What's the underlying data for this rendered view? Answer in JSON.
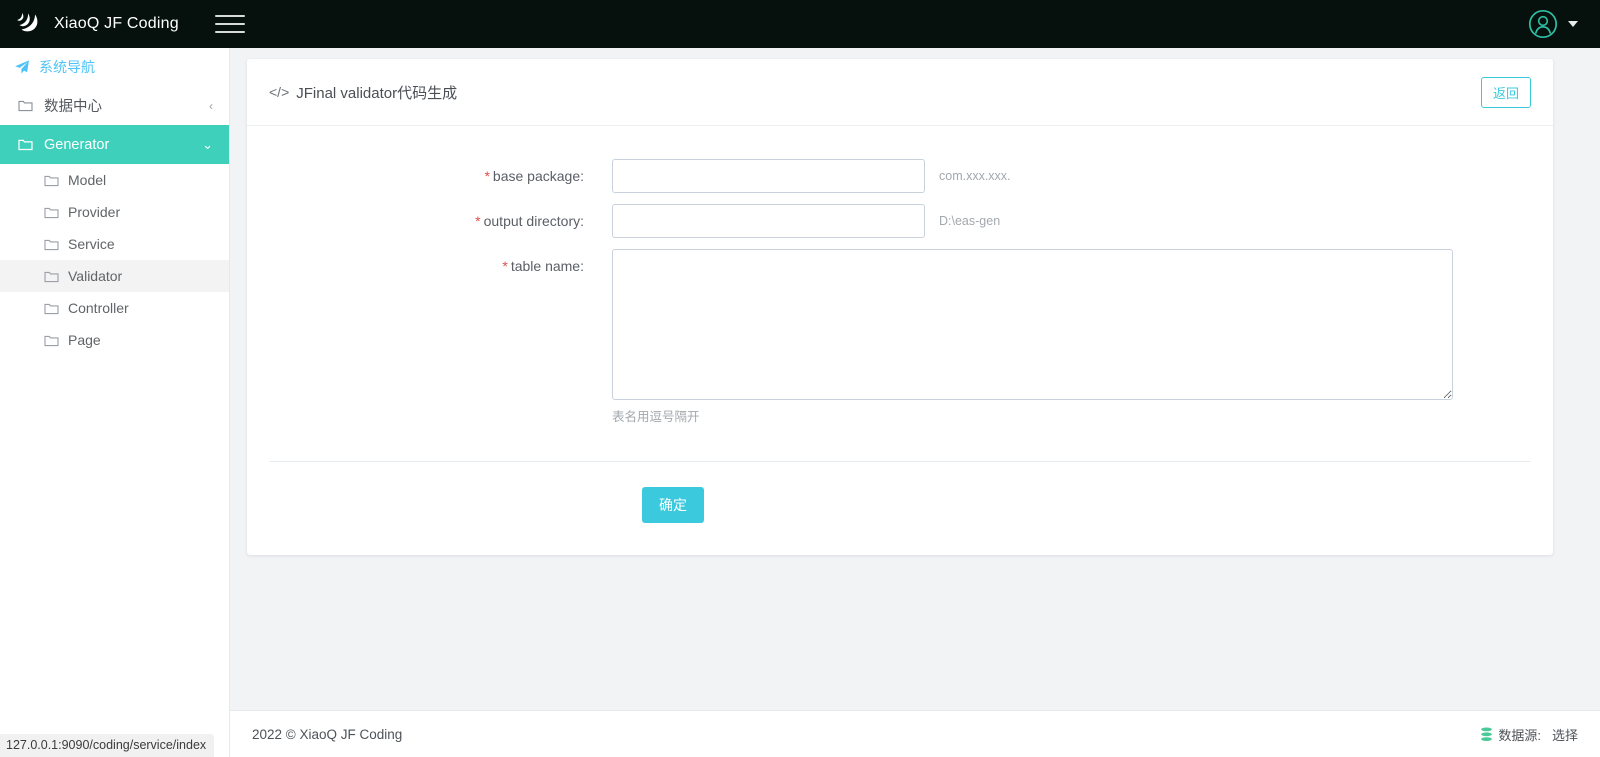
{
  "topbar": {
    "logo_icon": "crescent-logo-icon",
    "brand": "XiaoQ JF Coding",
    "menu_icon": "hamburger-icon",
    "avatar_icon": "user-avatar-icon",
    "caret_icon": "chevron-down-icon"
  },
  "sidebar": {
    "nav_header": "系统导航",
    "nav_header_icon": "send-icon",
    "items": [
      {
        "label": "数据中心",
        "icon": "folder-icon",
        "arrow": "‹",
        "active": false
      },
      {
        "label": "Generator",
        "icon": "folder-icon",
        "arrow": "⌄",
        "active": true
      }
    ],
    "sub_items": [
      {
        "label": "Model",
        "icon": "folder-icon",
        "selected": false
      },
      {
        "label": "Provider",
        "icon": "folder-icon",
        "selected": false
      },
      {
        "label": "Service",
        "icon": "folder-icon",
        "selected": false
      },
      {
        "label": "Validator",
        "icon": "folder-icon",
        "selected": true
      },
      {
        "label": "Controller",
        "icon": "folder-icon",
        "selected": false
      },
      {
        "label": "Page",
        "icon": "folder-icon",
        "selected": false
      }
    ]
  },
  "card": {
    "code_glyph": "</>",
    "title": "JFinal validator代码生成",
    "back_button": "返回"
  },
  "form": {
    "base_package": {
      "label": "base package:",
      "required_mark": "*",
      "value": "",
      "placeholder": "",
      "hint": "com.xxx.xxx."
    },
    "output_directory": {
      "label": "output directory:",
      "required_mark": "*",
      "value": "",
      "placeholder": "",
      "hint": "D:\\eas-gen"
    },
    "table_name": {
      "label": "table name:",
      "required_mark": "*",
      "value": "",
      "placeholder": "",
      "hint": "表名用逗号隔开"
    },
    "submit_label": "确定"
  },
  "footer": {
    "copyright": "2022 © XiaoQ JF Coding",
    "datasource_icon": "database-icon",
    "datasource_label": "数据源:",
    "datasource_action": "选择"
  },
  "statusbar": {
    "url": "127.0.0.1:9090/coding/service/index"
  },
  "colors": {
    "topbar_bg": "#06110d",
    "accent_teal": "#3ed0bb",
    "accent_cyan": "#3bc9dd",
    "nav_header_blue": "#4fc3f7",
    "required_red": "#e34d4d",
    "page_bg": "#f2f3f5"
  }
}
